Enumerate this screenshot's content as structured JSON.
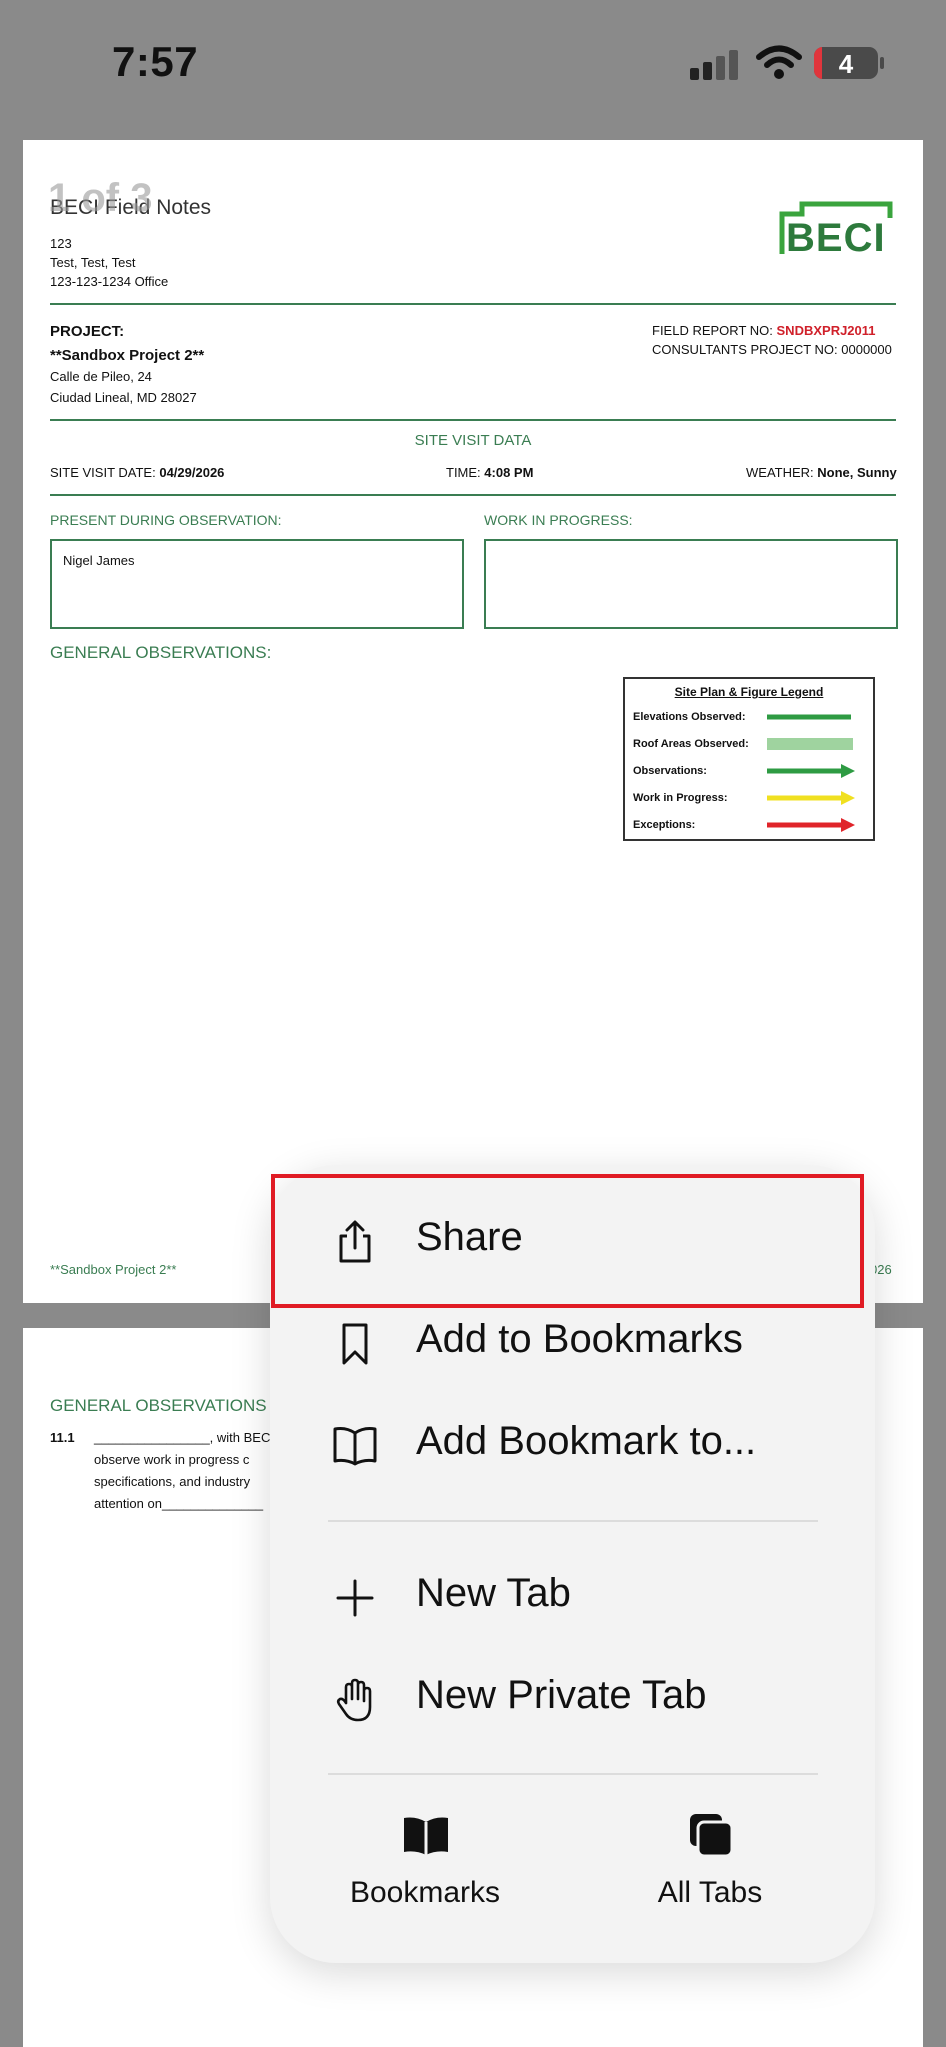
{
  "status_bar": {
    "time": "7:57",
    "battery": "4"
  },
  "page_indicator": "1 of 3",
  "doc": {
    "company": "BECI Field Notes",
    "addr1": "123",
    "addr2": "Test, Test, Test",
    "phone": "123-123-1234 Office",
    "logo": "BECI",
    "project_label": "PROJECT:",
    "project_name": "**Sandbox Project 2**",
    "project_addr1": "Calle de Pileo, 24",
    "project_addr2": "Ciudad Lineal, MD 28027",
    "field_report_label": "FIELD REPORT NO:",
    "field_report_no": "SNDBXPRJ2011",
    "consultants_label": "CONSULTANTS PROJECT NO:",
    "consultants_no": "0000000",
    "site_visit_heading": "SITE VISIT DATA",
    "site_visit_date_label": "SITE VISIT DATE:",
    "site_visit_date": "04/29/2026",
    "time_label": "TIME:",
    "time_value": "4:08 PM",
    "weather_label": "WEATHER:",
    "weather_value": "None, Sunny",
    "present_label": "PRESENT DURING OBSERVATION:",
    "present_value": "Nigel James",
    "wip_label": "WORK IN PROGRESS:",
    "general_obs_label": "GENERAL OBSERVATIONS:",
    "footer_left": "**Sandbox Project 2**",
    "footer_right": "026",
    "legend": {
      "title": "Site Plan & Figure Legend",
      "rows": [
        "Elevations Observed:",
        "Roof Areas Observed:",
        "Observations:",
        "Work in Progress:",
        "Exceptions:"
      ]
    }
  },
  "doc_page2": {
    "heading": "GENERAL OBSERVATIONS",
    "item_no": "11.1",
    "line1": "________________, with BEC",
    "line2": "observe work in progress c",
    "line3": "specifications, and industry",
    "line4": "attention on______________"
  },
  "menu": {
    "share": "Share",
    "add_to_bookmarks": "Add to Bookmarks",
    "add_bookmark_to": "Add Bookmark to...",
    "new_tab": "New Tab",
    "new_private_tab": "New Private Tab",
    "bookmarks": "Bookmarks",
    "all_tabs": "All Tabs"
  },
  "colors": {
    "accent_green": "#3a7d52",
    "report_red": "#d0202a",
    "highlight_red": "#e01b24"
  },
  "icons": [
    "share-icon",
    "bookmark-icon",
    "open-book-icon",
    "plus-icon",
    "hand-icon",
    "bookmarks-icon",
    "tabs-icon"
  ]
}
